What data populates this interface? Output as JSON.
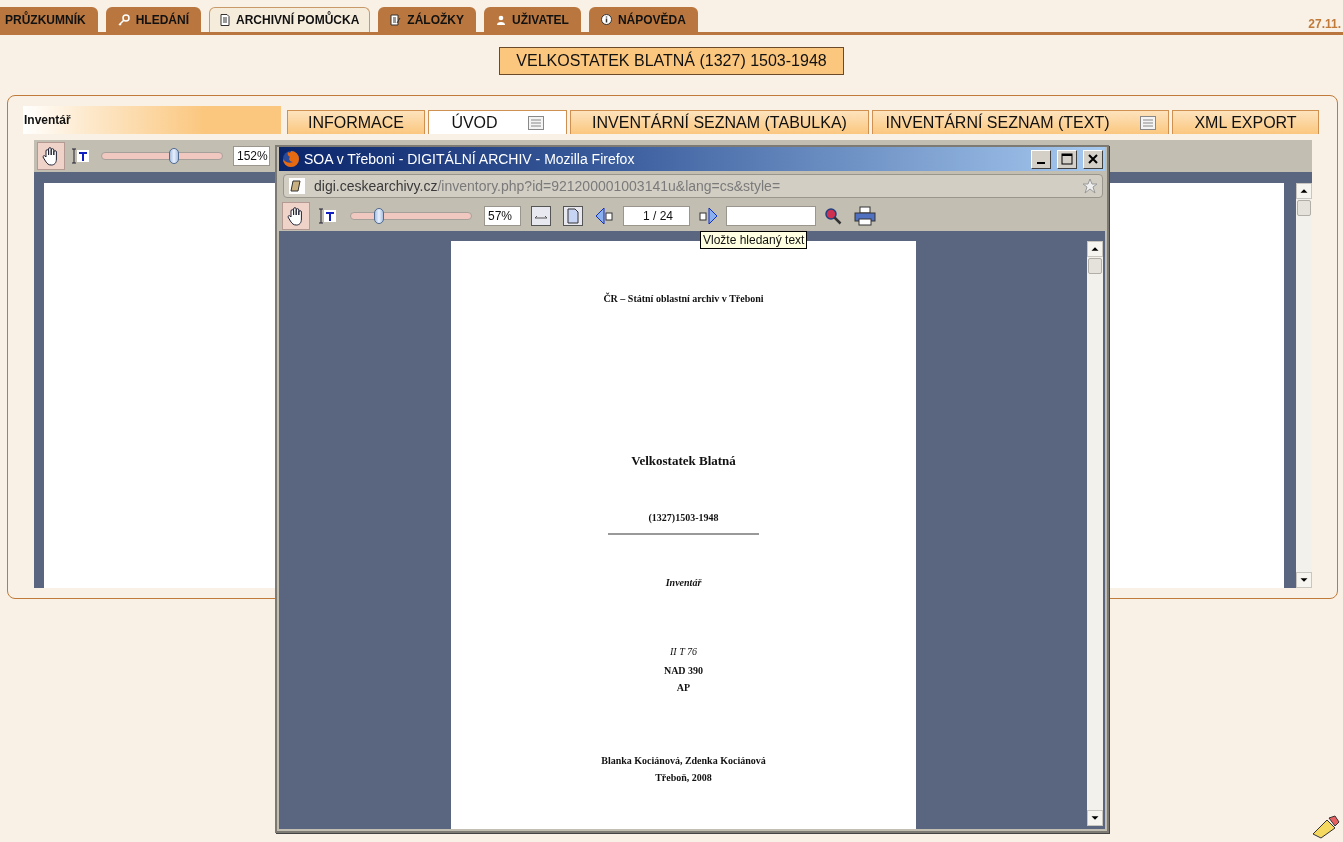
{
  "main_tabs": [
    {
      "label": "PRŮZKUMNÍK",
      "selected": false
    },
    {
      "label": "HLEDÁNÍ",
      "selected": false
    },
    {
      "label": "ARCHIVNÍ POMŮCKA",
      "selected": true
    },
    {
      "label": "ZÁLOŽKY",
      "selected": false
    },
    {
      "label": "UŽIVATEL",
      "selected": false
    },
    {
      "label": "NÁPOVĚDA",
      "selected": false
    }
  ],
  "date": "27.11.",
  "title": "VELKOSTATEK BLATNÁ (1327) 1503-1948",
  "panel": {
    "label": "Inventář",
    "tabs": [
      {
        "label": "INFORMACE",
        "selected": false,
        "menu_icon": false
      },
      {
        "label": "ÚVOD",
        "selected": true,
        "menu_icon": true
      },
      {
        "label": "INVENTÁRNÍ SEZNAM (TABULKA)",
        "selected": false,
        "menu_icon": false
      },
      {
        "label": "INVENTÁRNÍ SEZNAM (TEXT)",
        "selected": false,
        "menu_icon": true
      },
      {
        "label": "XML EXPORT",
        "selected": false,
        "menu_icon": false
      }
    ],
    "viewer": {
      "hand_tool": {
        "selected": true
      },
      "zoom_slider": {
        "level": 0.6
      },
      "zoom": "152%"
    }
  },
  "popup": {
    "title": "SOA v Třeboni - DIGITÁLNÍ ARCHIV - Mozilla Firefox",
    "url_host": "digi.ceskearchivy.cz",
    "url_path": "/inventory.php?id=921200001003141u&lang=cs&style=",
    "hand_tool": {
      "selected": true
    },
    "zoom_slider": {
      "level": 0.23
    },
    "zoom": "57%",
    "page": "1 / 24",
    "tooltip": "Vložte hledaný text",
    "document": [
      {
        "kind": "header",
        "text": "ČR – Státní oblastní archiv v Třeboni"
      },
      {
        "kind": "title",
        "text": "Velkostatek Blatná"
      },
      {
        "kind": "dates",
        "text": "(1327)1503-1948"
      },
      {
        "kind": "type",
        "text": "Inventář"
      },
      {
        "kind": "signature",
        "text": "II T 76"
      },
      {
        "kind": "line",
        "text": "NAD 390"
      },
      {
        "kind": "line",
        "text": "AP"
      },
      {
        "kind": "authors",
        "text": "Blanka Kociánová, Zdenka Kociánová"
      },
      {
        "kind": "line",
        "text": "Třeboň, 2008"
      }
    ]
  }
}
